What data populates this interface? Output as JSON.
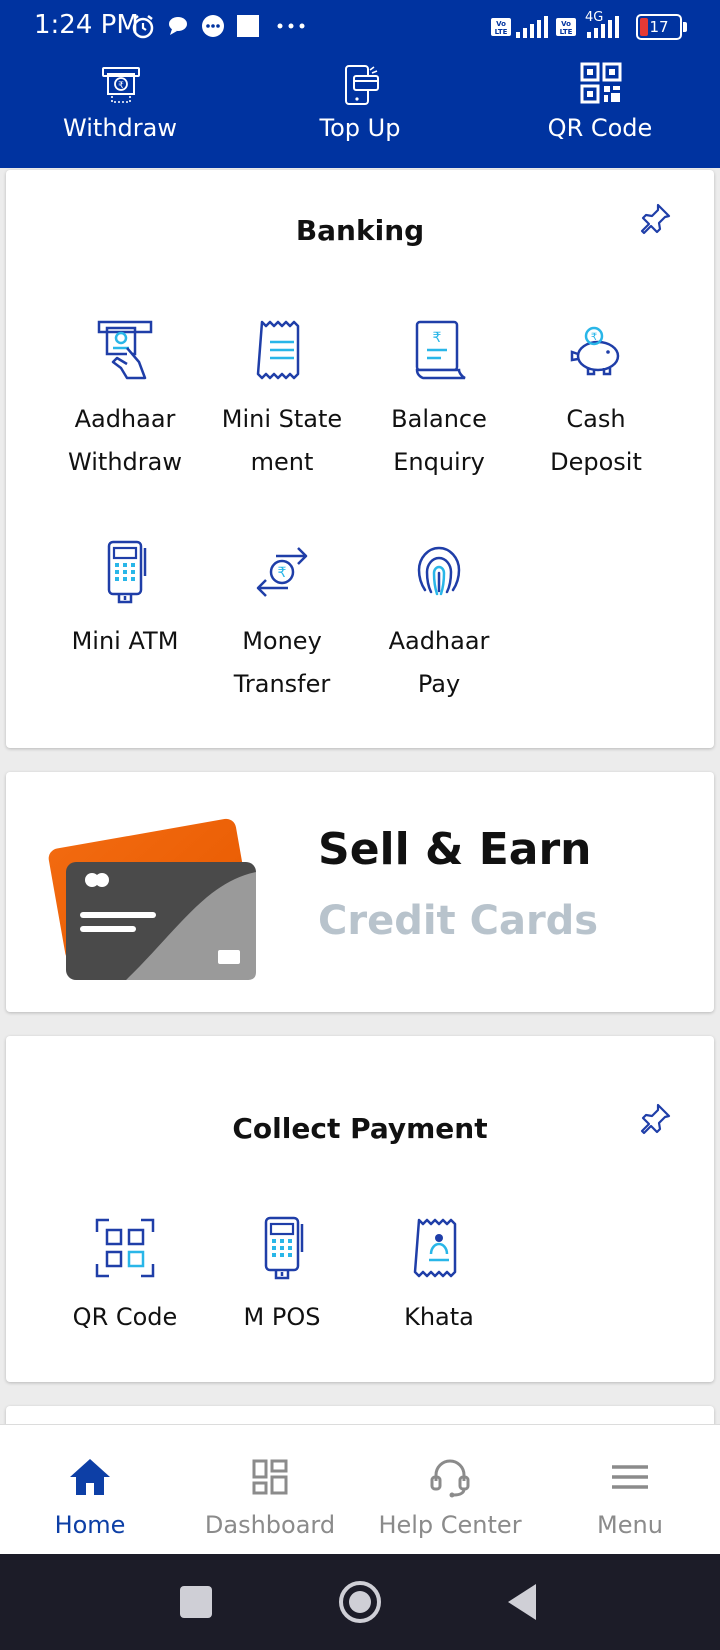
{
  "status_bar": {
    "time": "1:24 PM",
    "battery": "17",
    "network": "4G"
  },
  "quick_actions": [
    {
      "label": "Withdraw",
      "icon": "cash-withdraw-icon"
    },
    {
      "label": "Top Up",
      "icon": "phone-topup-icon"
    },
    {
      "label": "QR Code",
      "icon": "qr-code-icon"
    }
  ],
  "banking": {
    "title": "Banking",
    "items": [
      {
        "label_line1": "Aadhaar",
        "label_line2": "Withdraw",
        "icon": "aadhaar-withdraw-icon"
      },
      {
        "label_line1": "Mini State",
        "label_line2": "ment",
        "icon": "mini-statement-icon"
      },
      {
        "label_line1": "Balance",
        "label_line2": "Enquiry",
        "icon": "balance-enquiry-icon"
      },
      {
        "label_line1": "Cash",
        "label_line2": "Deposit",
        "icon": "cash-deposit-icon"
      },
      {
        "label_line1": "Mini ATM",
        "label_line2": "",
        "icon": "mini-atm-icon"
      },
      {
        "label_line1": "Money",
        "label_line2": "Transfer",
        "icon": "money-transfer-icon"
      },
      {
        "label_line1": "Aadhaar",
        "label_line2": "Pay",
        "icon": "fingerprint-icon"
      }
    ]
  },
  "promo": {
    "title": "Sell & Earn",
    "subtitle": "Credit Cards"
  },
  "collect_payment": {
    "title": "Collect Payment",
    "items": [
      {
        "label": "QR Code",
        "icon": "qr-scan-icon"
      },
      {
        "label": "M POS",
        "icon": "mpos-icon"
      },
      {
        "label": "Khata",
        "icon": "khata-icon"
      }
    ]
  },
  "bottom_nav": [
    {
      "label": "Home",
      "icon": "home-icon",
      "active": true
    },
    {
      "label": "Dashboard",
      "icon": "dashboard-icon",
      "active": false
    },
    {
      "label": "Help Center",
      "icon": "headset-icon",
      "active": false
    },
    {
      "label": "Menu",
      "icon": "menu-icon",
      "active": false
    }
  ],
  "colors": {
    "brand_blue": "#0033a0",
    "icon_blue": "#1f3ea8",
    "icon_cyan": "#29b6e8",
    "orange": "#f26a10",
    "muted_text": "#b8c3cc",
    "inactive_nav": "#8b8b8b",
    "system_nav_bg": "#1c1c28"
  }
}
